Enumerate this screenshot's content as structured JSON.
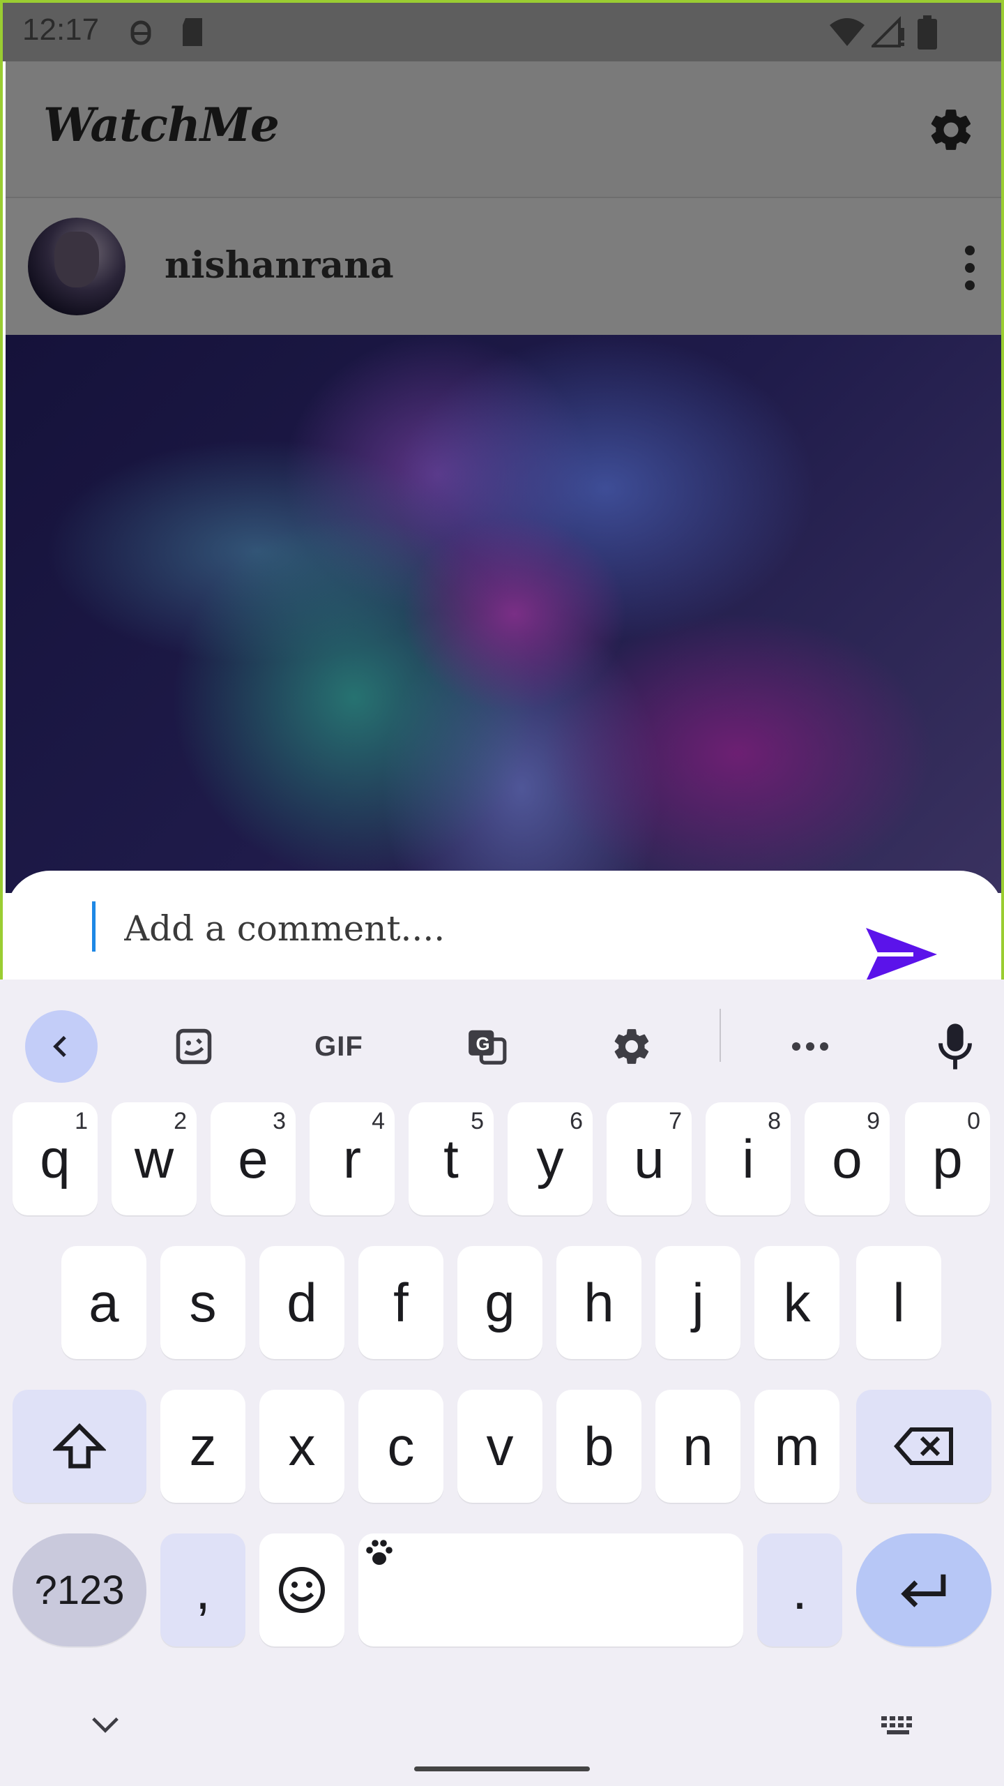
{
  "status_bar": {
    "time": "12:17"
  },
  "app": {
    "title": "WatchMe"
  },
  "post": {
    "username": "nishanrana"
  },
  "comment": {
    "placeholder": "Add a comment....",
    "value": ""
  },
  "keyboard": {
    "toolbar": {
      "gif_label": "GIF"
    },
    "rows": {
      "row1": [
        {
          "label": "q",
          "hint": "1"
        },
        {
          "label": "w",
          "hint": "2"
        },
        {
          "label": "e",
          "hint": "3"
        },
        {
          "label": "r",
          "hint": "4"
        },
        {
          "label": "t",
          "hint": "5"
        },
        {
          "label": "y",
          "hint": "6"
        },
        {
          "label": "u",
          "hint": "7"
        },
        {
          "label": "i",
          "hint": "8"
        },
        {
          "label": "o",
          "hint": "9"
        },
        {
          "label": "p",
          "hint": "0"
        }
      ],
      "row2": [
        "a",
        "s",
        "d",
        "f",
        "g",
        "h",
        "j",
        "k",
        "l"
      ],
      "row3": [
        "z",
        "x",
        "c",
        "v",
        "b",
        "n",
        "m"
      ],
      "row4": {
        "symbols": "?123",
        "comma": ",",
        "period": "."
      }
    }
  },
  "colors": {
    "accent_send": "#5b13ea",
    "caret": "#1e88e5",
    "frame_border": "#9acd32"
  }
}
